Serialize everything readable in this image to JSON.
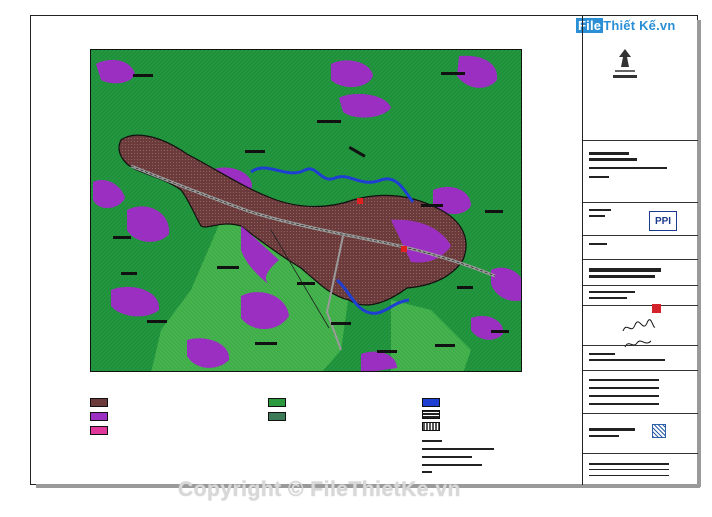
{
  "brand": {
    "file": "File",
    "thiet_ke": "Thiết Kế",
    "vn": ".vn"
  },
  "watermark": "Copyright © FileThietKe.vn",
  "title_block": {
    "ppi_label": "PPI"
  },
  "legend": {
    "title": "",
    "items": [
      {
        "color": "#6b3b3b",
        "pattern": "dots",
        "label": ""
      },
      {
        "color": "#9b2fc2",
        "pattern": "plain",
        "label": ""
      },
      {
        "color": "#e0379a",
        "pattern": "plain",
        "label": ""
      },
      {
        "color": "#2b9a3f",
        "pattern": "plain",
        "label": ""
      },
      {
        "color": "#3d7a57",
        "pattern": "plain",
        "label": ""
      },
      {
        "color": "#1e3fd1",
        "pattern": "plain",
        "label": ""
      },
      {
        "color": "#222222",
        "pattern": "hatch",
        "label": ""
      },
      {
        "color": "#555555",
        "pattern": "hatch",
        "label": ""
      }
    ]
  },
  "map_colors": {
    "forest": "#1f8f3a",
    "light_green": "#3fae48",
    "purple": "#9b2fc2",
    "urban": "#6b3b3b",
    "water": "#1e3fd1",
    "road": "#9a9a9a"
  }
}
